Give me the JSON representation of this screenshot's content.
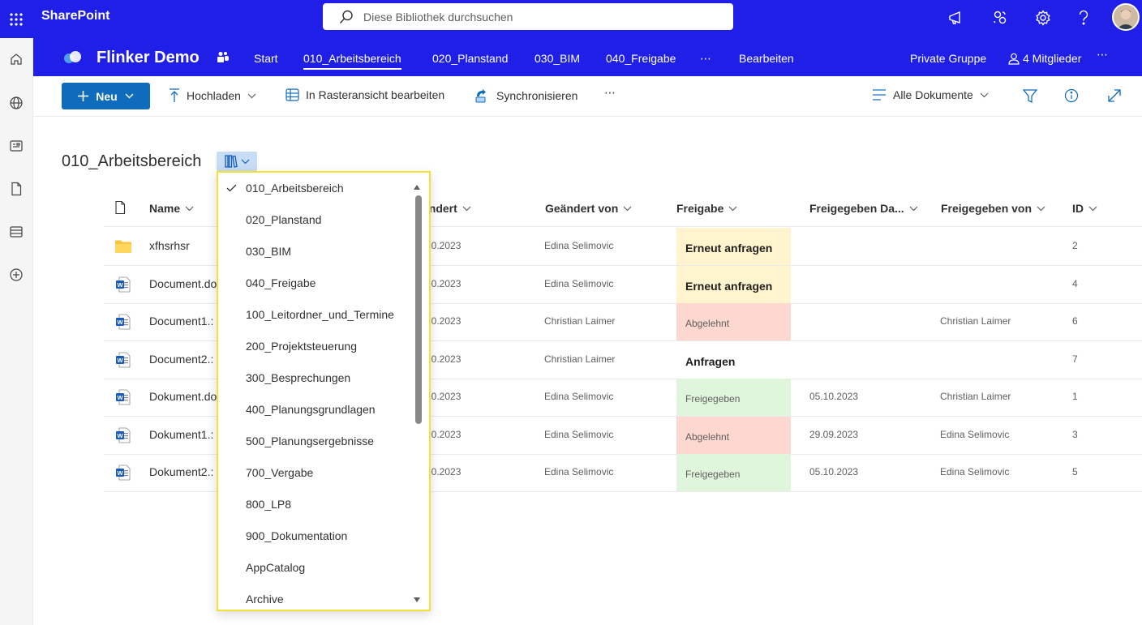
{
  "suite": {
    "brand": "SharePoint",
    "search_placeholder": "Diese Bibliothek durchsuchen"
  },
  "site": {
    "title": "Flinker Demo",
    "nav": [
      "Start",
      "010_Arbeitsbereich",
      "020_Planstand",
      "030_BIM",
      "040_Freigabe",
      "⋯",
      "Bearbeiten"
    ],
    "active_nav": "010_Arbeitsbereich",
    "group_label": "Private Gruppe",
    "members_label": "4 Mitglieder",
    "more": "⋯"
  },
  "commands": {
    "new_label": "Neu",
    "upload_label": "Hochladen",
    "grid_edit_label": "In Rasteransicht bearbeiten",
    "sync_label": "Synchronisieren",
    "more": "⋯",
    "view_label": "Alle Dokumente"
  },
  "library": {
    "title": "010_Arbeitsbereich"
  },
  "table": {
    "columns": [
      "Name",
      "ändert",
      "Geändert von",
      "Freigabe",
      "Freigegeben Da...",
      "Freigegeben von",
      "ID"
    ],
    "rows": [
      {
        "type": "folder",
        "name": "xfhsrhsr",
        "modified": "10.2023",
        "modified_by": "Edina Selimovic",
        "status": "Erneut anfragen",
        "status_kind": "warn",
        "approved_date": "",
        "approved_by": "",
        "id": "2"
      },
      {
        "type": "word",
        "name": "Document.do",
        "modified": "10.2023",
        "modified_by": "Edina Selimovic",
        "status": "Erneut anfragen",
        "status_kind": "warn",
        "approved_date": "",
        "approved_by": "",
        "id": "4"
      },
      {
        "type": "word",
        "name": "Document1.:",
        "modified": "10.2023",
        "modified_by": "Christian Laimer",
        "status": "Abgelehnt",
        "status_kind": "rejected",
        "approved_date": "",
        "approved_by": "Christian Laimer",
        "id": "6"
      },
      {
        "type": "word",
        "name": "Document2.:",
        "modified": "10.2023",
        "modified_by": "Christian Laimer",
        "status": "Anfragen",
        "status_kind": "request",
        "approved_date": "",
        "approved_by": "",
        "id": "7"
      },
      {
        "type": "word",
        "name": "Dokument.do",
        "modified": "10.2023",
        "modified_by": "Edina Selimovic",
        "status": "Freigegeben",
        "status_kind": "approved",
        "approved_date": "05.10.2023",
        "approved_by": "Christian Laimer",
        "id": "1"
      },
      {
        "type": "word",
        "name": "Dokument1.:",
        "modified": "10.2023",
        "modified_by": "Edina Selimovic",
        "status": "Abgelehnt",
        "status_kind": "rejected",
        "approved_date": "29.09.2023",
        "approved_by": "Edina Selimovic",
        "id": "3"
      },
      {
        "type": "word",
        "name": "Dokument2.:",
        "modified": "10.2023",
        "modified_by": "Edina Selimovic",
        "status": "Freigegeben",
        "status_kind": "approved",
        "approved_date": "05.10.2023",
        "approved_by": "Edina Selimovic",
        "id": "5"
      }
    ]
  },
  "library_dropdown": {
    "selected": "010_Arbeitsbereich",
    "items": [
      "010_Arbeitsbereich",
      "020_Planstand",
      "030_BIM",
      "040_Freigabe",
      "100_Leitordner_und_Termine",
      "200_Projektsteuerung",
      "300_Besprechungen",
      "400_Planungsgrundlagen",
      "500_Planungsergebnisse",
      "700_Vergabe",
      "800_LP8",
      "900_Dokumentation",
      "AppCatalog",
      "Archive"
    ]
  },
  "colors": {
    "suite_bar": "#1f1fe8",
    "primary_button": "#0f6cbd",
    "status_warn": "#fff4ce",
    "status_rejected": "#fdd8d0",
    "status_approved": "#dff6dd",
    "dropdown_outline": "#f2e137"
  },
  "icons": [
    "waffle-icon",
    "search-icon",
    "megaphone-icon",
    "connections-icon",
    "gear-icon",
    "help-icon",
    "home-icon",
    "globe-icon",
    "news-icon",
    "file-icon",
    "list-icon",
    "add-circle-icon",
    "teams-icon",
    "person-icon",
    "plus-icon",
    "upload-icon",
    "grid-icon",
    "sync-icon",
    "view-lines-icon",
    "filter-icon",
    "info-icon",
    "expand-icon",
    "library-view-icon",
    "folder-icon",
    "word-icon",
    "checkmark-icon"
  ]
}
